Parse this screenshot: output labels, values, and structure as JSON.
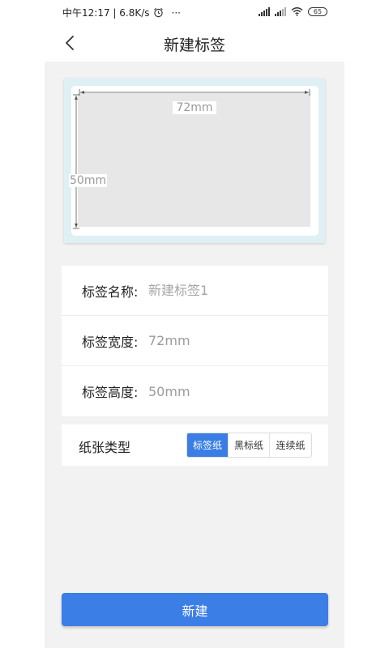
{
  "status_bar": {
    "time_speed": "中午12:17 | 6.8K/s",
    "more": "···",
    "battery": "65"
  },
  "nav": {
    "title": "新建标签",
    "back_icon": "chevron-left-icon"
  },
  "preview": {
    "width_label": "72mm",
    "height_label": "50mm"
  },
  "form": {
    "name_label": "标签名称:",
    "name_placeholder": "新建标签1",
    "width_label": "标签宽度:",
    "width_value": "72mm",
    "height_label": "标签高度:",
    "height_value": "50mm"
  },
  "paper_type": {
    "label": "纸张类型",
    "options": [
      "标签纸",
      "黑标纸",
      "连续纸"
    ],
    "selected": "标签纸"
  },
  "actions": {
    "create_label": "新建"
  },
  "colors": {
    "accent": "#3b7ee6",
    "background": "#f2f2f2",
    "preview_frame": "#dff0f5"
  }
}
